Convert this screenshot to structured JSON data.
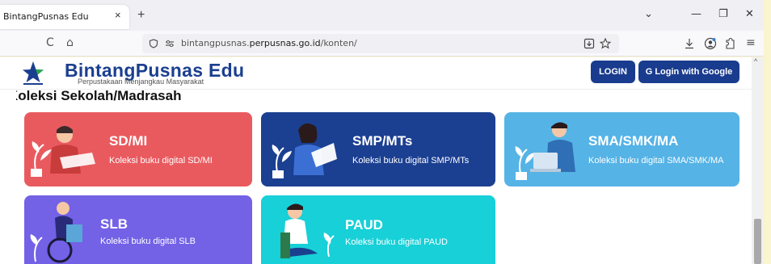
{
  "browser": {
    "tab_title": "BintangPusnas Edu",
    "tab_close": "×",
    "new_tab": "+",
    "url_host_prefix": "bintangpusnas.",
    "url_host_main": "perpusnas.go.id",
    "url_path": "/konten/",
    "controls": {
      "dropdown": "⌄",
      "minimize": "—",
      "restore": "❐",
      "close": "✕"
    },
    "nav": {
      "back": "→",
      "reload": "C",
      "home": "⌂",
      "menu": "≡"
    }
  },
  "site": {
    "brand": "BintangPusnas Edu",
    "tagline": "Perpustakaan Menjangkau Masyarakat",
    "login_label": "LOGIN",
    "google_label": "G  Login with Google"
  },
  "section": {
    "title": "Koleksi Sekolah/Madrasah"
  },
  "cards": [
    {
      "title": "SD/MI",
      "desc": "Koleksi buku digital SD/MI",
      "color": "#e95a5f"
    },
    {
      "title": "SMP/MTs",
      "desc": "Koleksi buku digital SMP/MTs",
      "color": "#1b3f91"
    },
    {
      "title": "SMA/SMK/MA",
      "desc": "Koleksi buku digital SMA/SMK/MA",
      "color": "#55b3e6"
    },
    {
      "title": "SLB",
      "desc": "Koleksi buku digital SLB",
      "color": "#7361e6"
    },
    {
      "title": "PAUD",
      "desc": "Koleksi buku digital PAUD",
      "color": "#17d0d8"
    }
  ]
}
